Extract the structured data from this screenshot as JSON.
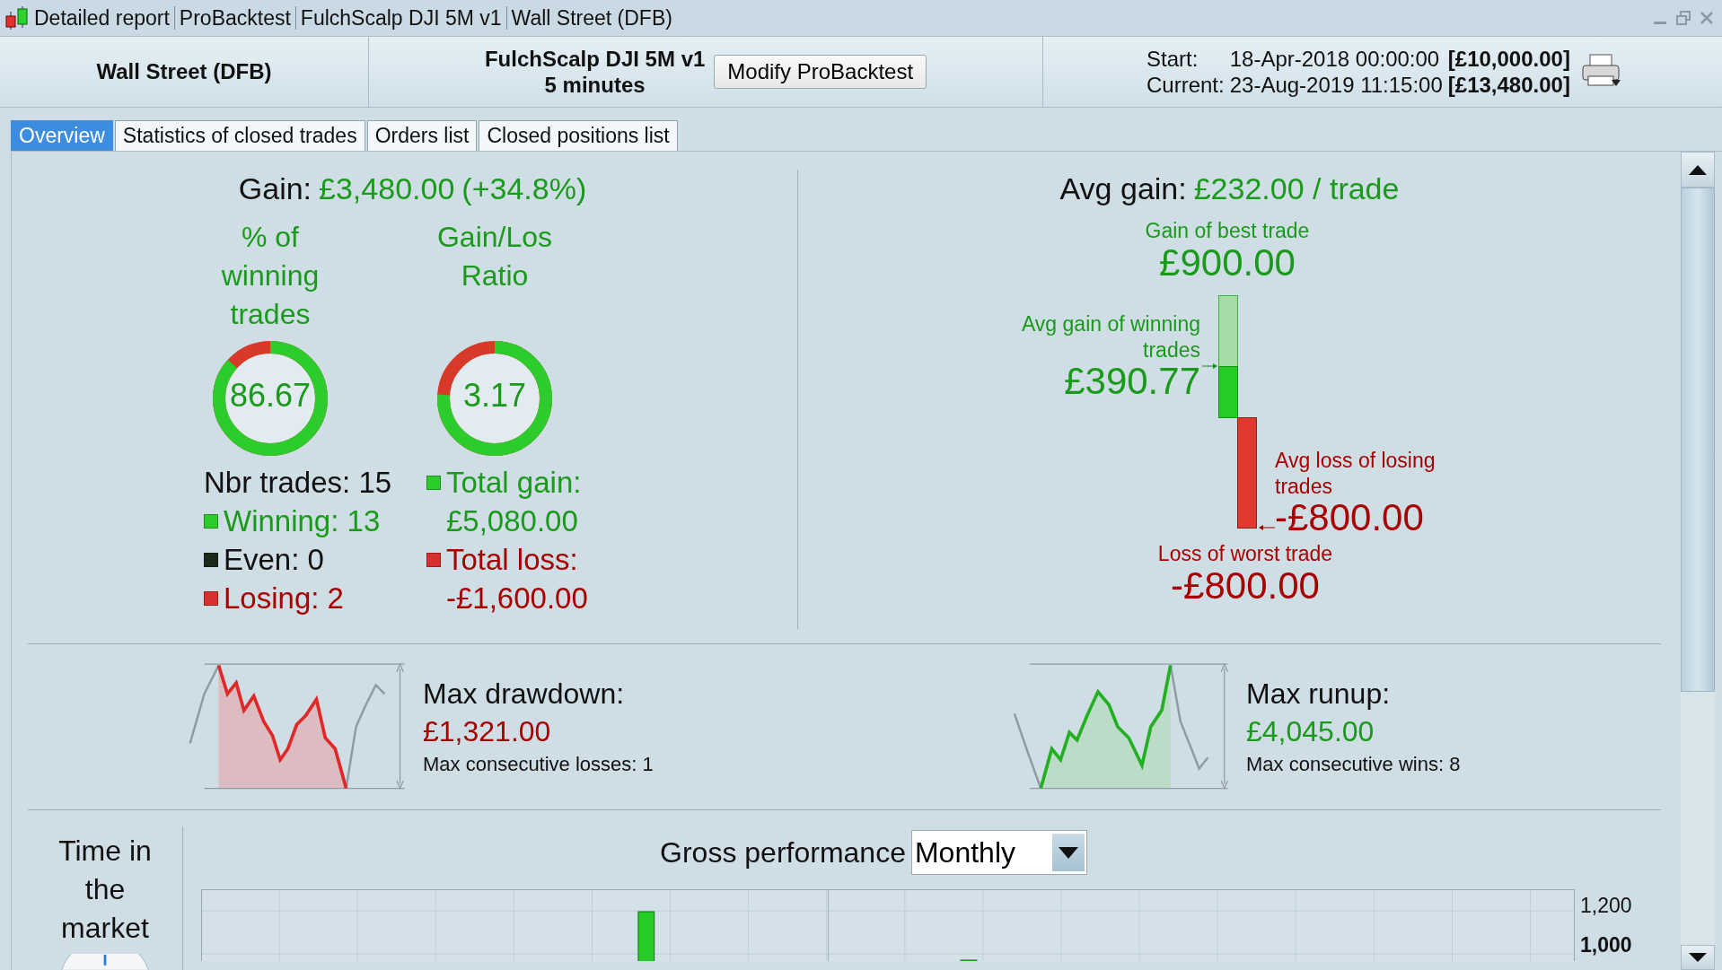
{
  "window": {
    "title_parts": [
      "Detailed report",
      "ProBacktest",
      "FulchScalp DJI 5M v1",
      "Wall Street (DFB)"
    ]
  },
  "header": {
    "instrument": "Wall Street (DFB)",
    "system": "FulchScalp DJI 5M v1",
    "timeframe": "5 minutes",
    "modify_button": "Modify ProBacktest",
    "start_label": "Start:",
    "start_date": "18-Apr-2018 00:00:00",
    "start_capital": "[£10,000.00]",
    "current_label": "Current:",
    "current_date": "23-Aug-2019 11:15:00",
    "current_capital": "[£13,480.00]"
  },
  "tabs": [
    {
      "label": "Overview",
      "selected": true
    },
    {
      "label": "Statistics of closed trades",
      "selected": false
    },
    {
      "label": "Orders list",
      "selected": false
    },
    {
      "label": "Closed positions list",
      "selected": false
    }
  ],
  "overview": {
    "gain_label": "Gain:",
    "gain_value": "£3,480.00",
    "gain_percent": "(+34.8%)",
    "gauges": [
      {
        "title_lines": [
          "% of",
          "winning",
          "trades"
        ],
        "value": "86.67",
        "level": 0.8667
      },
      {
        "title_lines": [
          "Gain/Los",
          "Ratio"
        ],
        "value": "3.17",
        "level": 0.76
      }
    ],
    "trade_counts": [
      {
        "label": "Nbr trades: 15",
        "kind": "total"
      },
      {
        "label": "Winning: 13",
        "kind": "win"
      },
      {
        "label": "Even: 0",
        "kind": "even"
      },
      {
        "label": "Losing: 2",
        "kind": "loss"
      }
    ],
    "totals": [
      {
        "label": "Total gain:",
        "value": "£5,080.00",
        "kind": "win"
      },
      {
        "label": "Total loss:",
        "value": "-£1,600.00",
        "kind": "loss"
      }
    ],
    "avg_gain_label": "Avg gain:",
    "avg_gain_value": "£232.00 / trade",
    "best_trade": {
      "label": "Gain of best trade",
      "value": "£900.00"
    },
    "avg_win": {
      "label": "Avg gain of winning trades",
      "value": "£390.77"
    },
    "avg_loss": {
      "label": "Avg loss of losing trades",
      "value": "-£800.00"
    },
    "worst_trade": {
      "label": "Loss of worst trade",
      "value": "-£800.00"
    }
  },
  "drawdown": {
    "title": "Max drawdown:",
    "value": "£1,321.00",
    "note": "Max consecutive losses: 1"
  },
  "runup": {
    "title": "Max runup:",
    "value": "£4,045.00",
    "note": "Max consecutive wins: 8"
  },
  "time_in_market": {
    "title_lines": [
      "Time in",
      "the",
      "market"
    ]
  },
  "gross_performance": {
    "title": "Gross performance",
    "period": "Monthly",
    "axis_labels": [
      {
        "text": "1,200",
        "bold": false
      },
      {
        "text": "1,000",
        "bold": true
      }
    ]
  }
}
